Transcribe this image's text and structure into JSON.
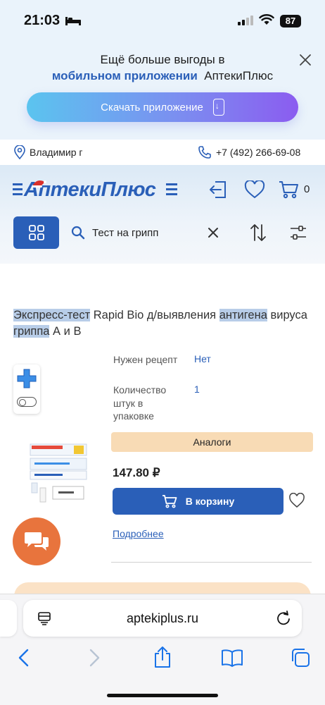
{
  "status_bar": {
    "time": "21:03",
    "battery": "87"
  },
  "promo": {
    "line1": "Ещё больше выгоды в",
    "line2_highlight": "мобильном приложении",
    "line2_rest": "АптекиПлюс",
    "download_label": "Скачать приложение"
  },
  "location": {
    "city": "Владимир г",
    "phone": "+7 (492) 266-69-08"
  },
  "header": {
    "logo": "АптекиПлюс",
    "cart_count": "0"
  },
  "search": {
    "value": "Тест на грипп"
  },
  "product": {
    "title_parts": [
      {
        "text": "Экспресс-тест",
        "hl": true
      },
      {
        "text": " Rapid Bio д/выявления ",
        "hl": false
      },
      {
        "text": "антигена",
        "hl": true
      },
      {
        "text": " вируса ",
        "hl": false
      },
      {
        "text": "гриппа",
        "hl": true
      },
      {
        "text": " А и В",
        "hl": false
      }
    ],
    "specs": [
      {
        "label": "Нужен рецепт",
        "value": "Нет"
      },
      {
        "label": "Количество штук в упаковке",
        "value": "1"
      }
    ],
    "analogs_label": "Аналоги",
    "price": "147.80 ₽",
    "to_cart_label": "В корзину",
    "more_label": "Подробнее"
  },
  "browser": {
    "url": "aptekiplus.ru"
  },
  "colors": {
    "brand_blue": "#2a5fb8",
    "chat_orange": "#e8743d",
    "analog_bg": "#f8dbb5"
  }
}
